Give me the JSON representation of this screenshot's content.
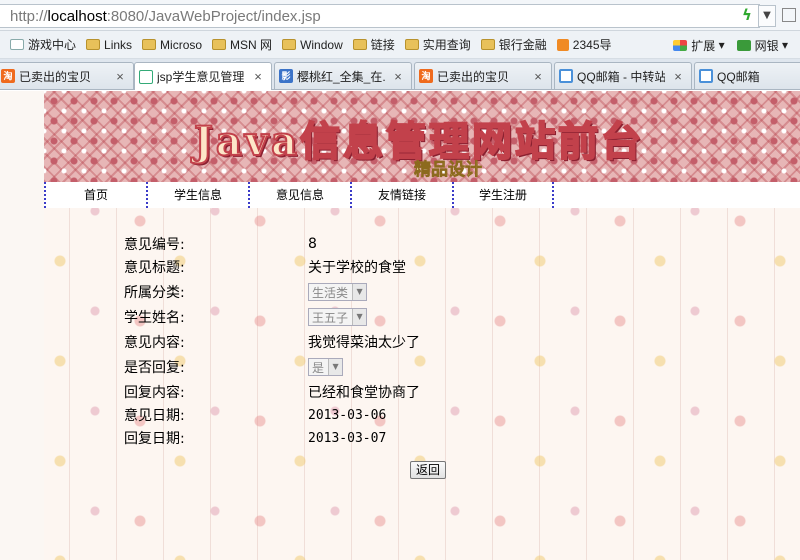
{
  "address_bar": {
    "scheme": "http://",
    "host": "localhost",
    "rest": ":8080/JavaWebProject/index.jsp"
  },
  "bookmarks": [
    {
      "label": "游戏中心",
      "icon": "page-icon"
    },
    {
      "label": "Links",
      "icon": "folder-icon"
    },
    {
      "label": "Microso",
      "icon": "folder-icon"
    },
    {
      "label": "MSN 网",
      "icon": "folder-icon"
    },
    {
      "label": "Window",
      "icon": "folder-icon"
    },
    {
      "label": "链接",
      "icon": "folder-icon"
    },
    {
      "label": "实用查询",
      "icon": "folder-icon"
    },
    {
      "label": "银行金融",
      "icon": "folder-icon"
    },
    {
      "label": "2345导",
      "icon": "site-2345-icon"
    }
  ],
  "bookmarks_right": {
    "extensions": "扩展",
    "netbank": "网银"
  },
  "tabs": [
    {
      "label": "已卖出的宝贝",
      "icon": "taobao-icon",
      "close": "×"
    },
    {
      "label": "jsp学生意见管理...",
      "icon": "jsp-icon",
      "close": "×"
    },
    {
      "label": "樱桃红_全集_在...",
      "icon": "baidu-icon",
      "close": "×"
    },
    {
      "label": "已卖出的宝贝",
      "icon": "taobao-icon",
      "close": "×"
    },
    {
      "label": "QQ邮箱 - 中转站",
      "icon": "qq-icon",
      "close": "×"
    },
    {
      "label": "QQ邮箱",
      "icon": "qq-icon",
      "close": ""
    }
  ],
  "banner": {
    "title": "Java信息管理网站前台",
    "subtitle": "精品设计"
  },
  "nav": [
    "首页",
    "学生信息",
    "意见信息",
    "友情链接",
    "学生注册"
  ],
  "form": {
    "labels": {
      "id": "意见编号:",
      "title": "意见标题:",
      "category": "所属分类:",
      "student": "学生姓名:",
      "content": "意见内容:",
      "replied": "是否回复:",
      "reply": "回复内容:",
      "date": "意见日期:",
      "reply_date": "回复日期:"
    },
    "values": {
      "id": "8",
      "title": "关于学校的食堂",
      "category": "生活类",
      "student": "王五子",
      "content": "我觉得菜油太少了",
      "replied": "是",
      "reply": "已经和食堂协商了",
      "date": "2013-03-06",
      "reply_date": "2013-03-07"
    }
  },
  "back_button": "返回"
}
